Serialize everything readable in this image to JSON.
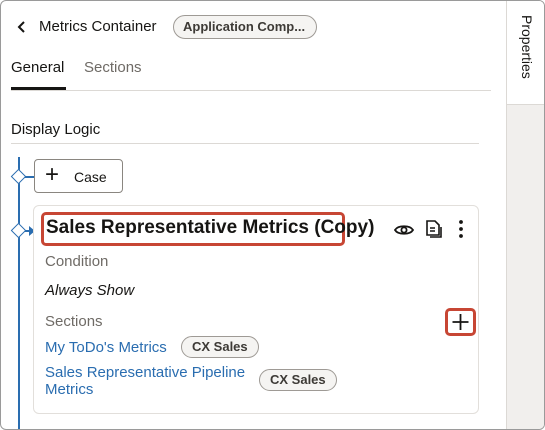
{
  "header": {
    "back_icon": "chevron-left-icon",
    "title": "Metrics Container",
    "badge": "Application Comp..."
  },
  "tabs": [
    {
      "label": "General",
      "active": true
    },
    {
      "label": "Sections",
      "active": false
    }
  ],
  "display_logic": {
    "heading": "Display Logic",
    "case_button_label": "Case"
  },
  "card": {
    "title": "Sales Representative Metrics (Copy)",
    "condition_label": "Condition",
    "condition_value": "Always Show",
    "sections_label": "Sections",
    "sections": [
      {
        "name": "My ToDo's Metrics",
        "badge": "CX Sales"
      },
      {
        "name": "Sales Representative Pipeline Metrics",
        "badge": "CX Sales"
      }
    ]
  },
  "side_panel": {
    "tab_label": "Properties"
  },
  "colors": {
    "accent": "#2a6db0",
    "highlight": "#c74634"
  }
}
